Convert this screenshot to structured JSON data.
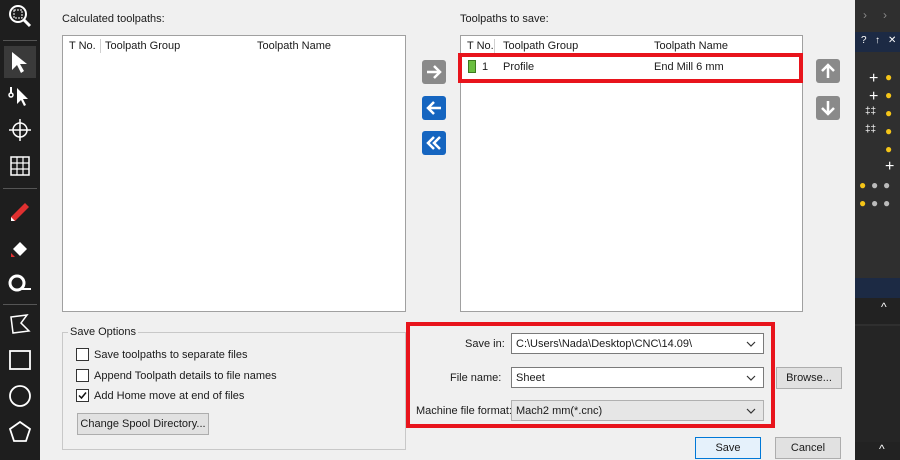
{
  "calculated": {
    "title": "Calculated toolpaths:",
    "columns": [
      "T No.",
      "Toolpath Group",
      "Toolpath Name"
    ]
  },
  "to_save": {
    "title": "Toolpaths to save:",
    "columns": [
      "T No.",
      "Toolpath Group",
      "Toolpath Name"
    ],
    "rows": [
      {
        "tno": "1",
        "group": "Profile",
        "name": "End Mill 6 mm"
      }
    ]
  },
  "save_options": {
    "title": "Save Options",
    "options": [
      {
        "label": "Save toolpaths to separate files",
        "checked": false
      },
      {
        "label": "Append Toolpath details to file names",
        "checked": false
      },
      {
        "label": "Add Home move at end of files",
        "checked": true
      }
    ],
    "spool_button": "Change Spool Directory..."
  },
  "fields": {
    "save_in_label": "Save in:",
    "save_in_value": "C:\\Users\\Nada\\Desktop\\CNC\\14.09\\",
    "file_name_label": "File name:",
    "file_name_value": "Sheet",
    "format_label": "Machine file format:",
    "format_value": "Mach2 mm(*.cnc)",
    "browse": "Browse..."
  },
  "buttons": {
    "save": "Save",
    "cancel": "Cancel"
  },
  "right_panel": {
    "question": "?",
    "pin": "↑",
    "close": "✕"
  },
  "colors": {
    "highlight": "#e8141c",
    "arrow_blue": "#1565c0",
    "arrow_grey": "#8a8a8a"
  }
}
